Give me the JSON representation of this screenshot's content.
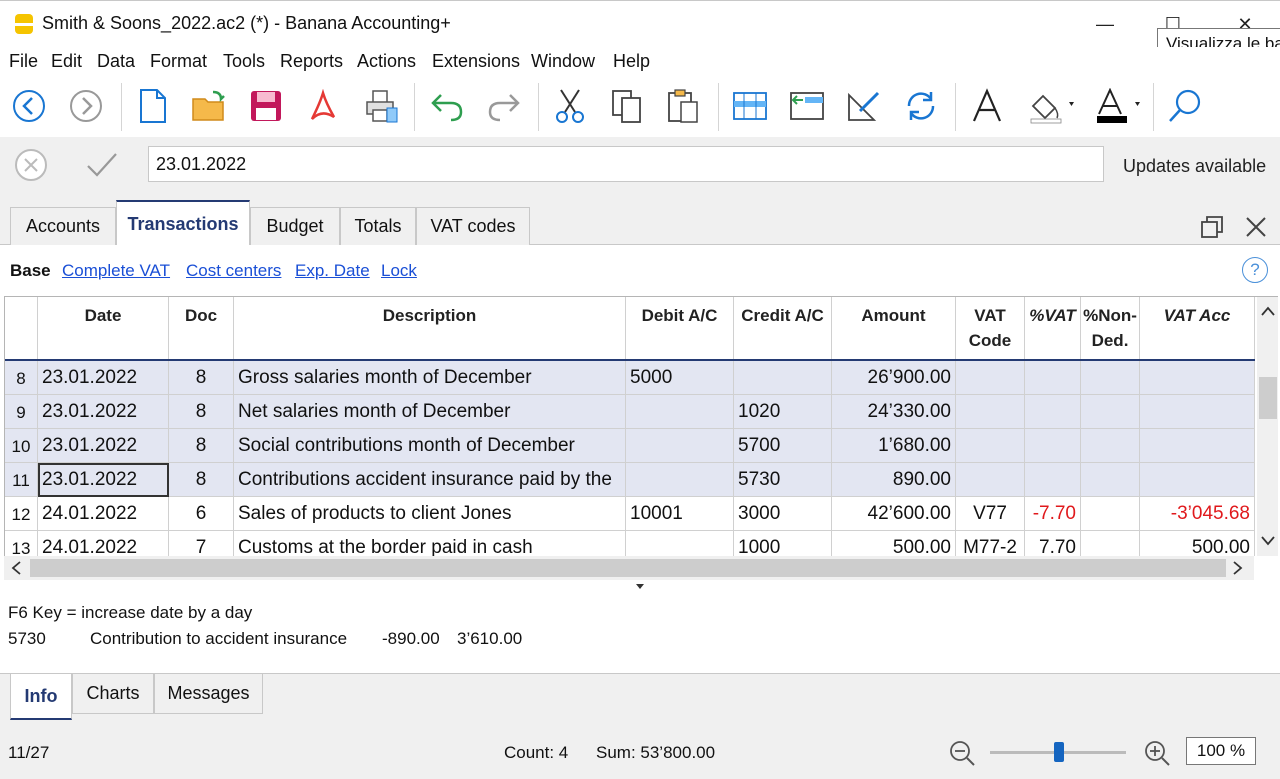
{
  "window": {
    "title": "Smith & Soons_2022.ac2 (*) - Banana Accounting+",
    "minimize": "—",
    "maximize": "☐",
    "close": "✕",
    "tooltip": "Visualizza le barre"
  },
  "menu": [
    "File",
    "Edit",
    "Data",
    "Format",
    "Tools",
    "Reports",
    "Actions",
    "Extensions",
    "Window",
    "Help"
  ],
  "edit_row": {
    "value": "23.01.2022",
    "updates": "Updates available"
  },
  "tabs": [
    "Accounts",
    "Transactions",
    "Budget",
    "Totals",
    "VAT codes"
  ],
  "views": {
    "active": "Base",
    "links": [
      "Complete VAT",
      "Cost centers",
      "Exp. Date",
      "Lock"
    ],
    "help": "?"
  },
  "table": {
    "headers": {
      "date": "Date",
      "doc": "Doc",
      "description": "Description",
      "debit": "Debit A/C",
      "credit": "Credit A/C",
      "amount": "Amount",
      "vat_code_1": "VAT",
      "vat_code_2": "Code",
      "pct_vat": "%VAT",
      "non_ded_1": "%Non-",
      "non_ded_2": "Ded.",
      "vat_acc": "VAT Acc"
    },
    "rows": [
      {
        "num": "8",
        "date": "23.01.2022",
        "doc": "8",
        "description": "Gross salaries month of December",
        "debit": "5000",
        "credit": "",
        "amount": "26’900.00",
        "vat_code": "",
        "pct_vat": "",
        "non_ded": "",
        "vat_acc": ""
      },
      {
        "num": "9",
        "date": "23.01.2022",
        "doc": "8",
        "description": "Net salaries month of December",
        "debit": "",
        "credit": "1020",
        "amount": "24’330.00",
        "vat_code": "",
        "pct_vat": "",
        "non_ded": "",
        "vat_acc": ""
      },
      {
        "num": "10",
        "date": "23.01.2022",
        "doc": "8",
        "description": "Social contributions month of December",
        "debit": "",
        "credit": "5700",
        "amount": "1’680.00",
        "vat_code": "",
        "pct_vat": "",
        "non_ded": "",
        "vat_acc": ""
      },
      {
        "num": "11",
        "date": "23.01.2022",
        "doc": "8",
        "description": "Contributions accident insurance paid by the",
        "debit": "",
        "credit": "5730",
        "amount": "890.00",
        "vat_code": "",
        "pct_vat": "",
        "non_ded": "",
        "vat_acc": ""
      },
      {
        "num": "12",
        "date": "24.01.2022",
        "doc": "6",
        "description": "Sales of products to client Jones",
        "debit": "10001",
        "credit": "3000",
        "amount": "42’600.00",
        "vat_code": "V77",
        "pct_vat": "-7.70",
        "non_ded": "",
        "vat_acc": "-3’045.68"
      },
      {
        "num": "13",
        "date": "24.01.2022",
        "doc": "7",
        "description": "Customs at the border paid in cash",
        "debit": "",
        "credit": "1000",
        "amount": "500.00",
        "vat_code": "M77-2",
        "pct_vat": "7.70",
        "non_ded": "",
        "vat_acc": "500.00"
      }
    ]
  },
  "info": {
    "hint": "F6 Key = increase date by a day",
    "account": "5730",
    "account_desc": "Contribution to accident insurance",
    "movement": "-890.00",
    "balance": "3’610.00"
  },
  "bottom_tabs": [
    "Info",
    "Charts",
    "Messages"
  ],
  "status": {
    "position": "11/27",
    "count": "Count: 4",
    "sum": "Sum: 53’800.00",
    "zoom": "100 %",
    "zoom_level_pct": 100
  },
  "colors": {
    "accent": "#243a73",
    "link": "#1a4fd6",
    "selection": "#e3e6f2",
    "negative": "#e0191c"
  }
}
